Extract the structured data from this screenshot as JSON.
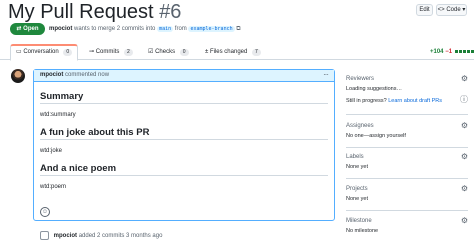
{
  "header": {
    "title": "My Pull Request",
    "number": "#6",
    "edit_label": "Edit",
    "code_label": "<> Code ▾",
    "state": "Open",
    "author": "mpociot",
    "meta_text": "wants to merge 2 commits into",
    "base_branch": "main",
    "from_text": "from",
    "head_branch": "example-branch"
  },
  "tabs": [
    {
      "label": "Conversation",
      "count": "0"
    },
    {
      "label": "Commits",
      "count": "2"
    },
    {
      "label": "Checks",
      "count": "0"
    },
    {
      "label": "Files changed",
      "count": "7"
    }
  ],
  "diffstat": {
    "additions": "+104",
    "deletions": "−1"
  },
  "comment": {
    "author": "mpociot",
    "action": "commented now",
    "sections": [
      {
        "heading": "Summary",
        "text": "wtd:summary"
      },
      {
        "heading": "A fun joke about this PR",
        "text": "wtd:joke"
      },
      {
        "heading": "And a nice poem",
        "text": "wtd:poem"
      }
    ]
  },
  "timeline": {
    "author": "mpociot",
    "text": "added 2 commits 3 months ago"
  },
  "sidebar": {
    "reviewers": {
      "title": "Reviewers",
      "value": "Loading suggestions…",
      "draft_prefix": "Still in progress?",
      "draft_link": "Learn about draft PRs"
    },
    "assignees": {
      "title": "Assignees",
      "value": "No one—assign yourself"
    },
    "labels": {
      "title": "Labels",
      "value": "None yet"
    },
    "projects": {
      "title": "Projects",
      "value": "None yet"
    },
    "milestone": {
      "title": "Milestone",
      "value": "No milestone"
    }
  },
  "colors": {
    "accent": "#0969da",
    "open_green": "#1f883d",
    "tab_underline": "#fd8c73"
  },
  "icons": [
    "copy-icon",
    "conversation-icon",
    "commit-icon",
    "checks-icon",
    "file-diff-icon",
    "kebab-icon",
    "smiley-icon",
    "gear-icon",
    "info-icon",
    "pr-open-icon",
    "commit-push-icon"
  ]
}
